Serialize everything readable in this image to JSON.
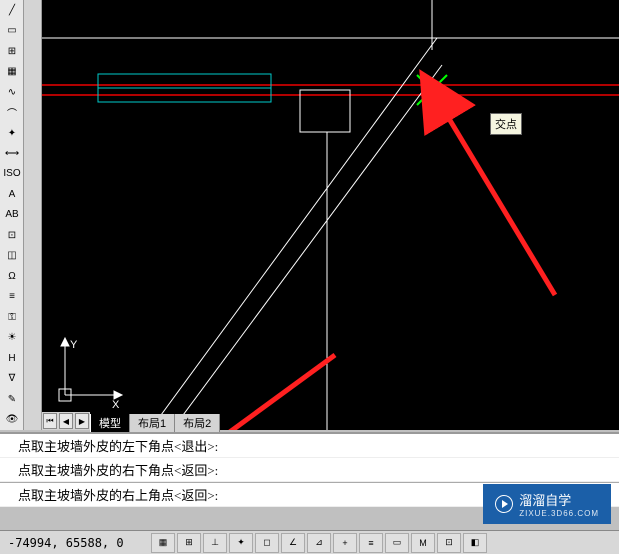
{
  "tooltip": {
    "text": "交点"
  },
  "tabs": {
    "model": "模型",
    "layout1": "布局1",
    "layout2": "布局2"
  },
  "command": {
    "line1": "点取主坡墙外皮的左下角点<退出>:",
    "line2": "点取主坡墙外皮的右下角点<返回>:",
    "current": "点取主坡墙外皮的右上角点<返回>:"
  },
  "status": {
    "coords": "-74994, 65588, 0"
  },
  "ucs": {
    "x": "X",
    "y": "Y"
  },
  "watermark": {
    "title": "溜溜自学",
    "sub": "ZIXUE.3D66.COM"
  },
  "icons": {
    "line": "╱",
    "rect": "▭",
    "grid": "⊞",
    "hatch": "▦",
    "curve": "∿",
    "arc": "⌒",
    "flame": "✦",
    "dim": "⟷",
    "iso": "ISO",
    "text": "A",
    "ab": "AB",
    "block": "⊡",
    "door": "◫",
    "omega": "Ω",
    "bars": "≡",
    "key": "⚿",
    "light": "☀",
    "h": "H",
    "inv": "∇",
    "pen": "✎",
    "eye": "👁"
  }
}
